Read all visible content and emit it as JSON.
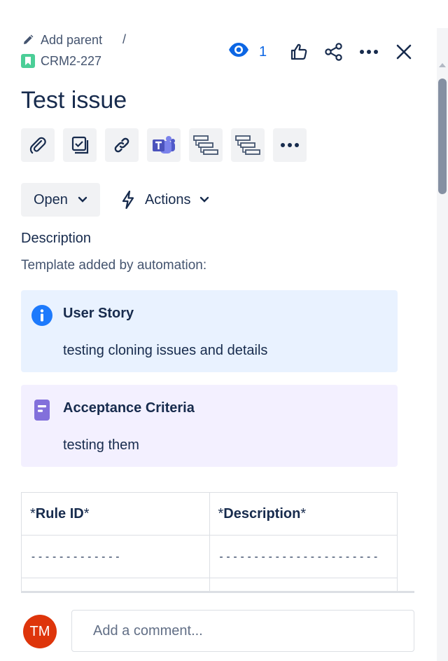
{
  "breadcrumb": {
    "add_parent": "Add parent",
    "separator": "/",
    "issue_key": "CRM2-227"
  },
  "header": {
    "watchers_count": "1"
  },
  "issue": {
    "title": "Test issue"
  },
  "toolbar": {
    "icons": [
      "attachment-icon",
      "checklist-icon",
      "link-icon",
      "teams-icon",
      "gantt-icon",
      "gantt-icon",
      "more-icon"
    ]
  },
  "status": {
    "current": "Open",
    "actions_label": "Actions"
  },
  "description": {
    "label": "Description",
    "intro": "Template added by automation:",
    "panels": [
      {
        "type": "info",
        "title": "User Story",
        "body": "testing cloning issues and details"
      },
      {
        "type": "note",
        "title": "Acceptance Criteria",
        "body": "testing them"
      }
    ],
    "table": {
      "headers": [
        {
          "prefix": "*",
          "bold": "Rule ID",
          "suffix": "*"
        },
        {
          "prefix": "*",
          "bold": "Description",
          "suffix": "*"
        }
      ],
      "rows": [
        [
          "-------------",
          "-----------------------"
        ]
      ]
    }
  },
  "comment": {
    "avatar_initials": "TM",
    "placeholder": "Add a comment..."
  },
  "colors": {
    "accent": "#0c66e4",
    "info_panel": "#e9f2ff",
    "note_panel": "#f3f0ff",
    "avatar": "#de350b",
    "story_badge": "#4bce97"
  }
}
